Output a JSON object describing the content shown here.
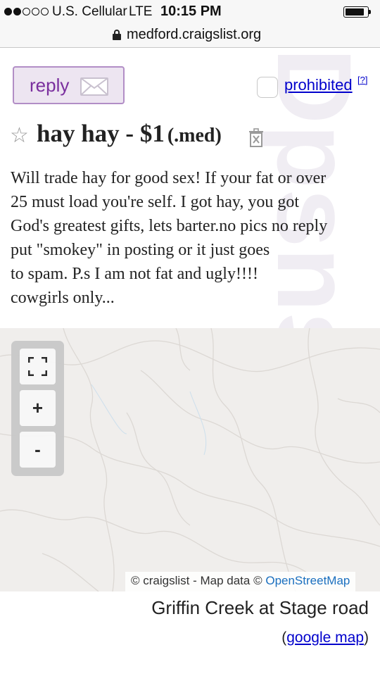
{
  "status_bar": {
    "signal_dots_filled": 2,
    "signal_dots_total": 5,
    "carrier": "U.S. Cellular",
    "network": "LTE",
    "time": "10:15 PM",
    "battery_level": 0.85
  },
  "browser": {
    "url": "medford.craigslist.org",
    "lock_icon": "lock-icon"
  },
  "watermark": "Dpsns",
  "actions": {
    "reply_label": "reply",
    "reply_icon": "envelope-icon",
    "prohibited_label": "prohibited",
    "help_label": "[?]"
  },
  "posting": {
    "star_icon": "star-icon",
    "title": "hay hay - $1",
    "area": "(.med)",
    "hide_icon": "trash-x-icon",
    "body_lines": [
      "Will trade hay for good sex! If your fat or over",
      "25 must load you're self. I got hay, you got",
      "God's greatest gifts, lets barter.no pics no reply",
      "put \"smokey\" in posting or it just goes",
      "to spam. P.s I am not fat and ugly!!!!",
      "cowgirls only..."
    ]
  },
  "map": {
    "fullscreen_icon": "fullscreen-icon",
    "zoom_in_label": "+",
    "zoom_out_label": "-",
    "attribution_prefix": "© craigslist - Map data © ",
    "attribution_link": "OpenStreetMap",
    "address": "Griffin Creek at Stage road",
    "google_map_open": "(",
    "google_map_link": "google map",
    "google_map_close": ")"
  },
  "colors": {
    "link": "#0000cc",
    "reply_text": "#7a2f9e",
    "reply_border": "#b28ec6",
    "reply_bg": "#ede5f1",
    "map_bg": "#f0eeec",
    "osm_link": "#1a6fbf"
  }
}
